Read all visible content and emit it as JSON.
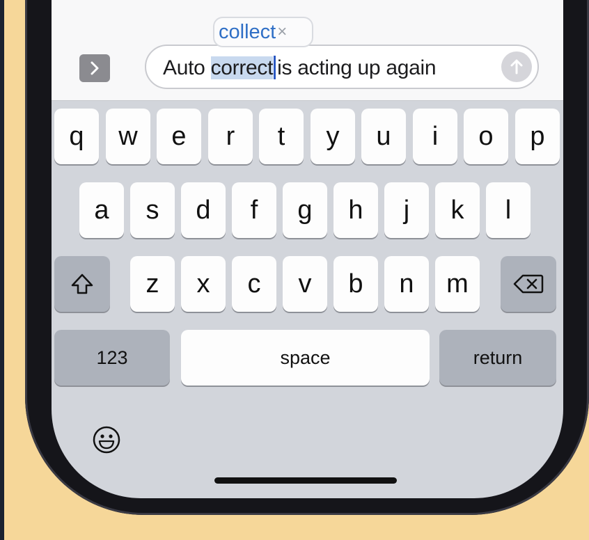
{
  "input": {
    "text_before": "Auto ",
    "highlighted": "correct",
    "text_after": "is acting up again"
  },
  "suggestion": {
    "word": "collect",
    "dismiss": "×"
  },
  "keyboard": {
    "row1": [
      "q",
      "w",
      "e",
      "r",
      "t",
      "y",
      "u",
      "i",
      "o",
      "p"
    ],
    "row2": [
      "a",
      "s",
      "d",
      "f",
      "g",
      "h",
      "j",
      "k",
      "l"
    ],
    "row3": [
      "z",
      "x",
      "c",
      "v",
      "b",
      "n",
      "m"
    ],
    "numbers_label": "123",
    "space_label": "space",
    "return_label": "return"
  },
  "icons": [
    "chevron-right-icon",
    "send-arrow-icon",
    "shift-icon",
    "backspace-icon",
    "emoji-icon",
    "close-icon"
  ]
}
